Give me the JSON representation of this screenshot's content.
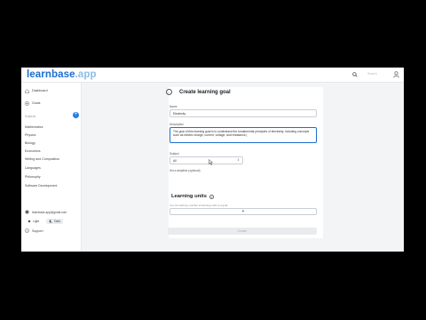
{
  "app": {
    "logo_main": "learnbase",
    "logo_suffix": ".app",
    "search_placeholder": "Search"
  },
  "sidebar": {
    "nav": [
      {
        "label": "Dashboard",
        "icon": "home-icon"
      },
      {
        "label": "Goals",
        "icon": "target-icon"
      }
    ],
    "subjects_label": "Subjects",
    "add_label": "+",
    "subjects": [
      "Mathematics",
      "Physics",
      "Biology",
      "Economics",
      "Writing and Composition",
      "Languages",
      "Philosophy",
      "Software Development"
    ],
    "email": "learnbase.app@gmail.com",
    "theme_light": "Light",
    "theme_dark": "Dark",
    "support": "Support"
  },
  "form": {
    "title": "Create learning goal",
    "back_glyph": "←",
    "name_label": "Name",
    "name_value": "Electricity",
    "description_label": "Description",
    "description_value": "The goal of this learning goal is to understand the fundamental principles of electricity, including concepts such as electric charge, current, voltage, and resistance.|",
    "subject_label": "Subject",
    "subject_value": "All",
    "deadline_label": "Set a deadline (optional)",
    "units_title": "Learning units",
    "units_hint": "You can add any number of learning units to a goal.",
    "add_unit_label": "+",
    "create_label": "Create"
  }
}
